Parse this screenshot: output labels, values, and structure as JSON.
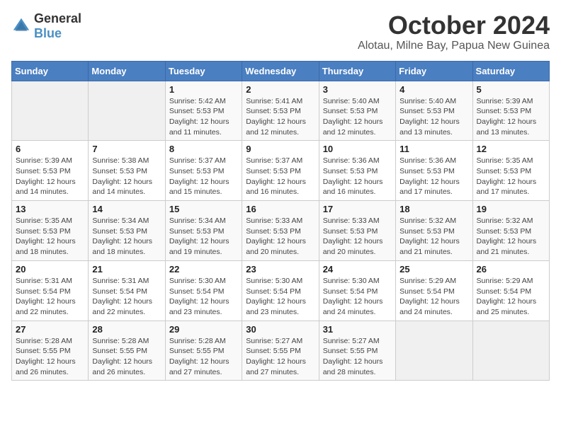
{
  "logo": {
    "general": "General",
    "blue": "Blue"
  },
  "title": "October 2024",
  "location": "Alotau, Milne Bay, Papua New Guinea",
  "headers": [
    "Sunday",
    "Monday",
    "Tuesday",
    "Wednesday",
    "Thursday",
    "Friday",
    "Saturday"
  ],
  "weeks": [
    [
      {
        "day": "",
        "info": ""
      },
      {
        "day": "",
        "info": ""
      },
      {
        "day": "1",
        "info": "Sunrise: 5:42 AM\nSunset: 5:53 PM\nDaylight: 12 hours\nand 11 minutes."
      },
      {
        "day": "2",
        "info": "Sunrise: 5:41 AM\nSunset: 5:53 PM\nDaylight: 12 hours\nand 12 minutes."
      },
      {
        "day": "3",
        "info": "Sunrise: 5:40 AM\nSunset: 5:53 PM\nDaylight: 12 hours\nand 12 minutes."
      },
      {
        "day": "4",
        "info": "Sunrise: 5:40 AM\nSunset: 5:53 PM\nDaylight: 12 hours\nand 13 minutes."
      },
      {
        "day": "5",
        "info": "Sunrise: 5:39 AM\nSunset: 5:53 PM\nDaylight: 12 hours\nand 13 minutes."
      }
    ],
    [
      {
        "day": "6",
        "info": "Sunrise: 5:39 AM\nSunset: 5:53 PM\nDaylight: 12 hours\nand 14 minutes."
      },
      {
        "day": "7",
        "info": "Sunrise: 5:38 AM\nSunset: 5:53 PM\nDaylight: 12 hours\nand 14 minutes."
      },
      {
        "day": "8",
        "info": "Sunrise: 5:37 AM\nSunset: 5:53 PM\nDaylight: 12 hours\nand 15 minutes."
      },
      {
        "day": "9",
        "info": "Sunrise: 5:37 AM\nSunset: 5:53 PM\nDaylight: 12 hours\nand 16 minutes."
      },
      {
        "day": "10",
        "info": "Sunrise: 5:36 AM\nSunset: 5:53 PM\nDaylight: 12 hours\nand 16 minutes."
      },
      {
        "day": "11",
        "info": "Sunrise: 5:36 AM\nSunset: 5:53 PM\nDaylight: 12 hours\nand 17 minutes."
      },
      {
        "day": "12",
        "info": "Sunrise: 5:35 AM\nSunset: 5:53 PM\nDaylight: 12 hours\nand 17 minutes."
      }
    ],
    [
      {
        "day": "13",
        "info": "Sunrise: 5:35 AM\nSunset: 5:53 PM\nDaylight: 12 hours\nand 18 minutes."
      },
      {
        "day": "14",
        "info": "Sunrise: 5:34 AM\nSunset: 5:53 PM\nDaylight: 12 hours\nand 18 minutes."
      },
      {
        "day": "15",
        "info": "Sunrise: 5:34 AM\nSunset: 5:53 PM\nDaylight: 12 hours\nand 19 minutes."
      },
      {
        "day": "16",
        "info": "Sunrise: 5:33 AM\nSunset: 5:53 PM\nDaylight: 12 hours\nand 20 minutes."
      },
      {
        "day": "17",
        "info": "Sunrise: 5:33 AM\nSunset: 5:53 PM\nDaylight: 12 hours\nand 20 minutes."
      },
      {
        "day": "18",
        "info": "Sunrise: 5:32 AM\nSunset: 5:53 PM\nDaylight: 12 hours\nand 21 minutes."
      },
      {
        "day": "19",
        "info": "Sunrise: 5:32 AM\nSunset: 5:53 PM\nDaylight: 12 hours\nand 21 minutes."
      }
    ],
    [
      {
        "day": "20",
        "info": "Sunrise: 5:31 AM\nSunset: 5:54 PM\nDaylight: 12 hours\nand 22 minutes."
      },
      {
        "day": "21",
        "info": "Sunrise: 5:31 AM\nSunset: 5:54 PM\nDaylight: 12 hours\nand 22 minutes."
      },
      {
        "day": "22",
        "info": "Sunrise: 5:30 AM\nSunset: 5:54 PM\nDaylight: 12 hours\nand 23 minutes."
      },
      {
        "day": "23",
        "info": "Sunrise: 5:30 AM\nSunset: 5:54 PM\nDaylight: 12 hours\nand 23 minutes."
      },
      {
        "day": "24",
        "info": "Sunrise: 5:30 AM\nSunset: 5:54 PM\nDaylight: 12 hours\nand 24 minutes."
      },
      {
        "day": "25",
        "info": "Sunrise: 5:29 AM\nSunset: 5:54 PM\nDaylight: 12 hours\nand 24 minutes."
      },
      {
        "day": "26",
        "info": "Sunrise: 5:29 AM\nSunset: 5:54 PM\nDaylight: 12 hours\nand 25 minutes."
      }
    ],
    [
      {
        "day": "27",
        "info": "Sunrise: 5:28 AM\nSunset: 5:55 PM\nDaylight: 12 hours\nand 26 minutes."
      },
      {
        "day": "28",
        "info": "Sunrise: 5:28 AM\nSunset: 5:55 PM\nDaylight: 12 hours\nand 26 minutes."
      },
      {
        "day": "29",
        "info": "Sunrise: 5:28 AM\nSunset: 5:55 PM\nDaylight: 12 hours\nand 27 minutes."
      },
      {
        "day": "30",
        "info": "Sunrise: 5:27 AM\nSunset: 5:55 PM\nDaylight: 12 hours\nand 27 minutes."
      },
      {
        "day": "31",
        "info": "Sunrise: 5:27 AM\nSunset: 5:55 PM\nDaylight: 12 hours\nand 28 minutes."
      },
      {
        "day": "",
        "info": ""
      },
      {
        "day": "",
        "info": ""
      }
    ]
  ]
}
